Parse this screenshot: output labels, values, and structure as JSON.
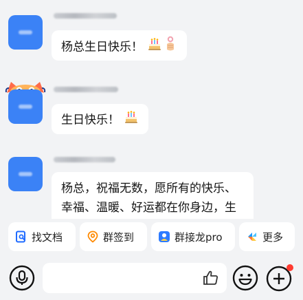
{
  "messages": [
    {
      "text_lines": [
        "杨总生日快乐！"
      ],
      "emojis": [
        "cake-emoji",
        "rich-hand-emoji"
      ]
    },
    {
      "text_lines": [
        "生日快乐！"
      ],
      "emojis": [
        "cake-emoji"
      ]
    },
    {
      "text_lines": [
        "杨总，祝福无数，愿所有的快乐、",
        "幸福、温暖、好运都在你身边，生"
      ],
      "emojis": []
    }
  ],
  "quick_actions": [
    {
      "label": "找文档",
      "icon": "find-document-icon",
      "color": "#1f6bff"
    },
    {
      "label": "群签到",
      "icon": "location-checkin-icon",
      "color": "#ff8a00"
    },
    {
      "label": "群接龙pro",
      "icon": "solitaire-icon",
      "color": "#2d7bff"
    },
    {
      "label": "更多",
      "icon": "more-apps-icon",
      "color": "#1e9bff"
    }
  ],
  "input": {
    "voice_icon": "microphone-icon",
    "like_icon": "thumbs-up-icon",
    "emoji_icon": "smiley-icon",
    "plus_icon": "plus-icon",
    "notification_dot_color": "#ff3b30"
  }
}
